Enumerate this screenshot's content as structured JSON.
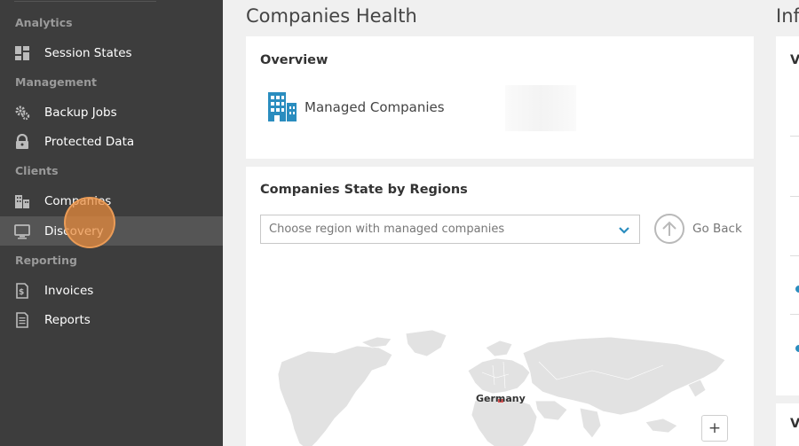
{
  "sidebar": {
    "sections": {
      "analytics": "Analytics",
      "management": "Management",
      "clients": "Clients",
      "reporting": "Reporting"
    },
    "items": [
      {
        "label": "Session States",
        "icon": "dashboard-grid-icon"
      },
      {
        "label": "Backup Jobs",
        "icon": "gear-cogs-icon"
      },
      {
        "label": "Protected Data",
        "icon": "lock-icon"
      },
      {
        "label": "Companies",
        "icon": "buildings-icon"
      },
      {
        "label": "Discovery",
        "icon": "monitor-icon",
        "active": true
      },
      {
        "label": "Invoices",
        "icon": "invoice-icon"
      },
      {
        "label": "Reports",
        "icon": "report-icon"
      }
    ]
  },
  "main": {
    "title": "Companies Health",
    "right_title_partial": "Inf",
    "overview": {
      "title": "Overview",
      "managed_companies_label": "Managed Companies",
      "icon": "office-building-icon"
    },
    "regions": {
      "title": "Companies State by Regions",
      "select_placeholder": "Choose region with managed companies",
      "go_back_label": "Go Back",
      "map_label": "Germany",
      "zoom_in_label": "+"
    },
    "right_panel": {
      "letter_top": "V",
      "letter_bottom": "V"
    }
  },
  "colors": {
    "sidebar_bg": "#3d3d3d",
    "sidebar_active": "#555555",
    "accent_blue": "#2a8dbf",
    "click_indicator": "#ec8c3c"
  }
}
